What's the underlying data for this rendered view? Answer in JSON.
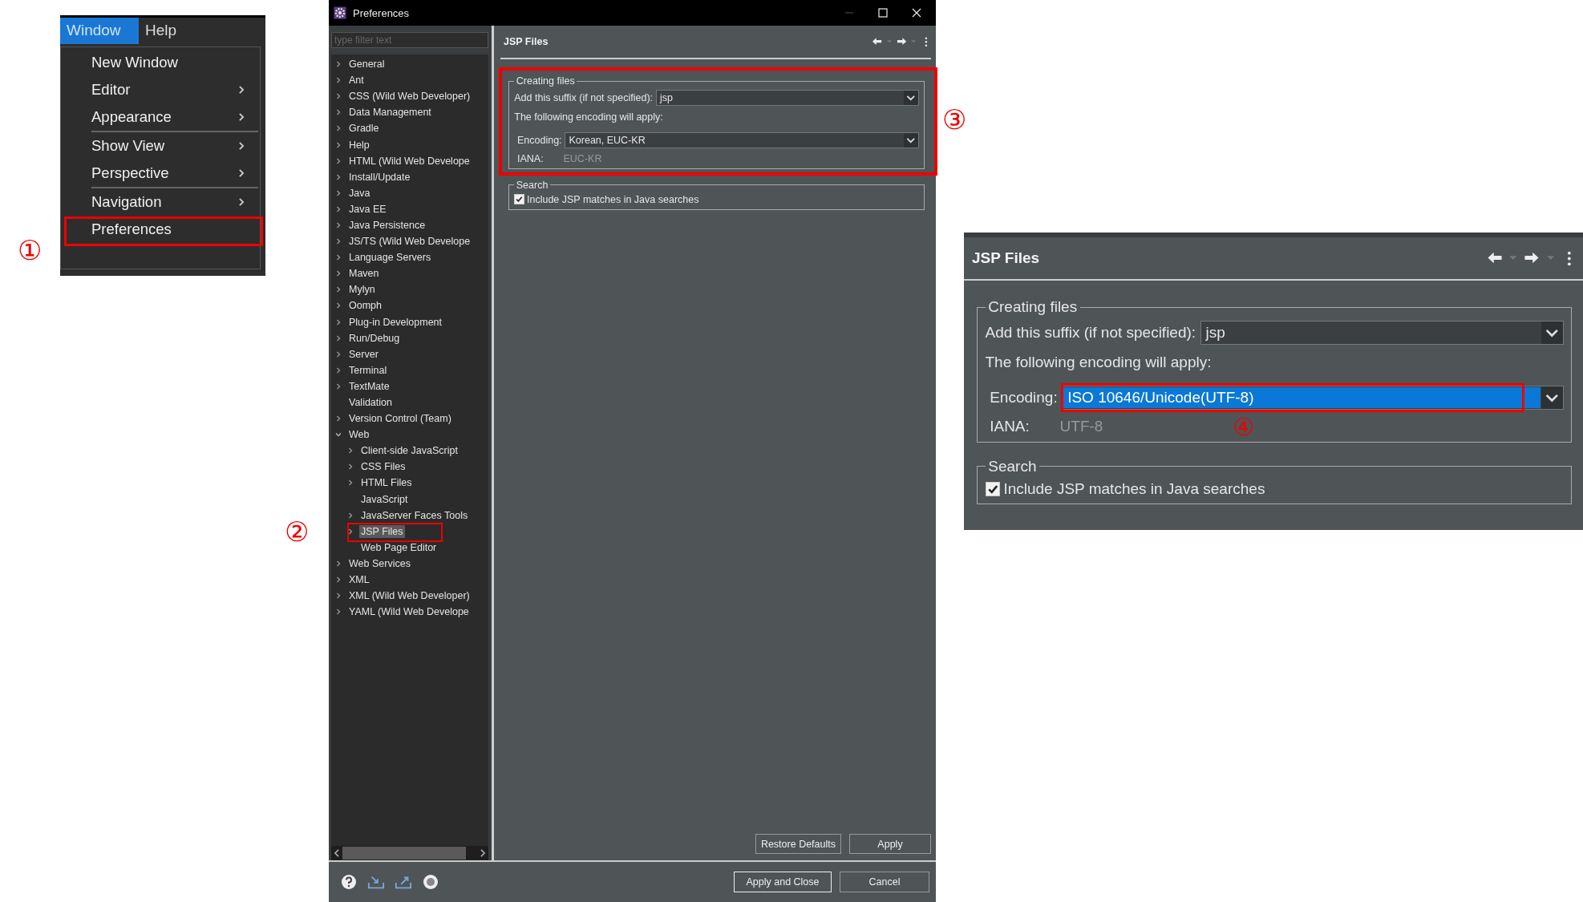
{
  "menu": {
    "bar": [
      {
        "label": "Window",
        "selected": true
      },
      {
        "label": "Help",
        "selected": false
      }
    ],
    "groups": [
      [
        {
          "label": "New Window",
          "submenu": false,
          "callout": false
        },
        {
          "label": "Editor",
          "submenu": true,
          "callout": false
        },
        {
          "label": "Appearance",
          "submenu": true,
          "callout": false
        }
      ],
      [
        {
          "label": "Show View",
          "submenu": true,
          "callout": false
        },
        {
          "label": "Perspective",
          "submenu": true,
          "callout": false
        }
      ],
      [
        {
          "label": "Navigation",
          "submenu": true,
          "callout": false
        },
        {
          "label": "Preferences",
          "submenu": false,
          "callout": true
        }
      ]
    ],
    "step": "①"
  },
  "preferences": {
    "title": "Preferences",
    "filter_placeholder": "type filter text",
    "step": "②",
    "tree": [
      {
        "label": "General",
        "expandable": true,
        "expanded": false,
        "selected": false,
        "callout": false
      },
      {
        "label": "Ant",
        "expandable": true,
        "expanded": false,
        "selected": false,
        "callout": false
      },
      {
        "label": "CSS (Wild Web Developer)",
        "expandable": true,
        "expanded": false,
        "selected": false,
        "callout": false
      },
      {
        "label": "Data Management",
        "expandable": true,
        "expanded": false,
        "selected": false,
        "callout": false
      },
      {
        "label": "Gradle",
        "expandable": true,
        "expanded": false,
        "selected": false,
        "callout": false
      },
      {
        "label": "Help",
        "expandable": true,
        "expanded": false,
        "selected": false,
        "callout": false
      },
      {
        "label": "HTML (Wild Web Develope",
        "expandable": true,
        "expanded": false,
        "selected": false,
        "callout": false
      },
      {
        "label": "Install/Update",
        "expandable": true,
        "expanded": false,
        "selected": false,
        "callout": false
      },
      {
        "label": "Java",
        "expandable": true,
        "expanded": false,
        "selected": false,
        "callout": false
      },
      {
        "label": "Java EE",
        "expandable": true,
        "expanded": false,
        "selected": false,
        "callout": false
      },
      {
        "label": "Java Persistence",
        "expandable": true,
        "expanded": false,
        "selected": false,
        "callout": false
      },
      {
        "label": "JS/TS (Wild Web Develope",
        "expandable": true,
        "expanded": false,
        "selected": false,
        "callout": false
      },
      {
        "label": "Language Servers",
        "expandable": true,
        "expanded": false,
        "selected": false,
        "callout": false
      },
      {
        "label": "Maven",
        "expandable": true,
        "expanded": false,
        "selected": false,
        "callout": false
      },
      {
        "label": "Mylyn",
        "expandable": true,
        "expanded": false,
        "selected": false,
        "callout": false
      },
      {
        "label": "Oomph",
        "expandable": true,
        "expanded": false,
        "selected": false,
        "callout": false
      },
      {
        "label": "Plug-in Development",
        "expandable": true,
        "expanded": false,
        "selected": false,
        "callout": false
      },
      {
        "label": "Run/Debug",
        "expandable": true,
        "expanded": false,
        "selected": false,
        "callout": false
      },
      {
        "label": "Server",
        "expandable": true,
        "expanded": false,
        "selected": false,
        "callout": false
      },
      {
        "label": "Terminal",
        "expandable": true,
        "expanded": false,
        "selected": false,
        "callout": false
      },
      {
        "label": "TextMate",
        "expandable": true,
        "expanded": false,
        "selected": false,
        "callout": false
      },
      {
        "label": "Validation",
        "expandable": false,
        "expanded": false,
        "selected": false,
        "callout": false
      },
      {
        "label": "Version Control (Team)",
        "expandable": true,
        "expanded": false,
        "selected": false,
        "callout": false
      },
      {
        "label": "Web",
        "expandable": true,
        "expanded": true,
        "selected": false,
        "callout": false,
        "children": [
          {
            "label": "Client-side JavaScript",
            "expandable": true,
            "expanded": false,
            "selected": false,
            "callout": false
          },
          {
            "label": "CSS Files",
            "expandable": true,
            "expanded": false,
            "selected": false,
            "callout": false
          },
          {
            "label": "HTML Files",
            "expandable": true,
            "expanded": false,
            "selected": false,
            "callout": false
          },
          {
            "label": "JavaScript",
            "expandable": false,
            "expanded": false,
            "selected": false,
            "callout": false
          },
          {
            "label": "JavaServer Faces Tools",
            "expandable": true,
            "expanded": false,
            "selected": false,
            "callout": false
          },
          {
            "label": "JSP Files",
            "expandable": true,
            "expanded": false,
            "selected": true,
            "callout": true
          },
          {
            "label": "Web Page Editor",
            "expandable": false,
            "expanded": false,
            "selected": false,
            "callout": false
          }
        ]
      },
      {
        "label": "Web Services",
        "expandable": true,
        "expanded": false,
        "selected": false,
        "callout": false
      },
      {
        "label": "XML",
        "expandable": true,
        "expanded": false,
        "selected": false,
        "callout": false
      },
      {
        "label": "XML (Wild Web Developer)",
        "expandable": true,
        "expanded": false,
        "selected": false,
        "callout": false
      },
      {
        "label": "YAML (Wild Web Develope",
        "expandable": true,
        "expanded": false,
        "selected": false,
        "callout": false
      }
    ],
    "page": {
      "title": "JSP Files",
      "creating_group": {
        "legend": "Creating files",
        "suffix_label": "Add this suffix (if not specified):",
        "suffix_value": "jsp",
        "encoding_note": "The following encoding will apply:",
        "encoding_label": "Encoding:",
        "encoding_value": "Korean, EUC-KR",
        "encoding_selected": false,
        "encoding_callout": false,
        "iana_label": "IANA:",
        "iana_value": "EUC-KR",
        "callout": true,
        "step": "③"
      },
      "search_group": {
        "legend": "Search",
        "checkbox_label": "Include JSP matches in Java searches",
        "checked": true
      }
    },
    "page_buttons": [
      "Restore Defaults",
      "Apply"
    ],
    "dialog_buttons": [
      {
        "label": "Apply and Close",
        "default": true
      },
      {
        "label": "Cancel",
        "default": false
      }
    ]
  },
  "detail": {
    "title": "JSP Files",
    "creating_group": {
      "legend": "Creating files",
      "suffix_label": "Add this suffix (if not specified):",
      "suffix_value": "jsp",
      "encoding_note": "The following encoding will apply:",
      "encoding_label": "Encoding:",
      "encoding_value": "ISO 10646/Unicode(UTF-8)",
      "encoding_selected": true,
      "encoding_callout": true,
      "iana_label": "IANA:",
      "iana_value": "UTF-8",
      "callout": false,
      "step": "④"
    },
    "search_group": {
      "legend": "Search",
      "checkbox_label": "Include JSP matches in Java searches",
      "checked": true
    }
  }
}
